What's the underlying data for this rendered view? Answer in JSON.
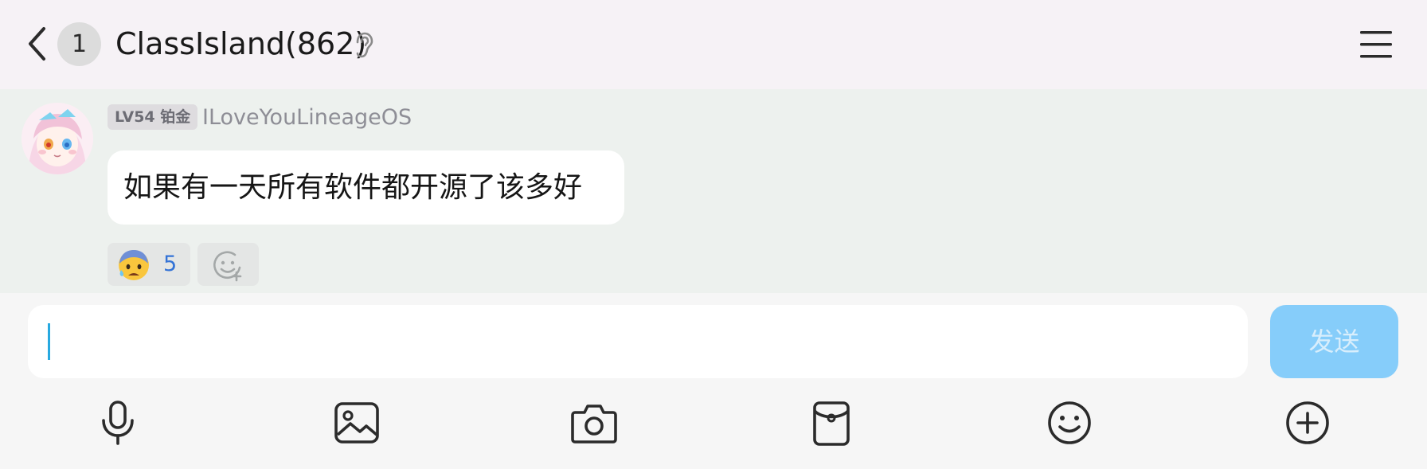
{
  "header": {
    "back_icon": "chevron-left-icon",
    "unread_count": "1",
    "title": "ClassIsland(862)",
    "mute_icon": "ear-icon",
    "menu_icon": "hamburger-menu-icon",
    "background": "#f6f2f6"
  },
  "message": {
    "avatar_icon": "anime-girl-avatar",
    "level_badge": "LV54 铂金",
    "sender_name": "ILoveYouLineageOS",
    "text": "如果有一天所有软件都开源了该多好",
    "reactions": [
      {
        "emoji": "anxious-face-with-sweat-icon",
        "count": "5"
      }
    ],
    "add_reaction_icon": "add-emoji-icon",
    "area_background": "#edf1ee"
  },
  "composer": {
    "input_value": "",
    "send_label": "发送",
    "send_color": "#86cdfa",
    "cursor_color": "#28a9e0"
  },
  "toolbar": {
    "items": [
      {
        "icon": "microphone-icon"
      },
      {
        "icon": "image-icon"
      },
      {
        "icon": "camera-icon"
      },
      {
        "icon": "red-packet-icon"
      },
      {
        "icon": "emoji-icon"
      },
      {
        "icon": "plus-circle-icon"
      }
    ]
  }
}
